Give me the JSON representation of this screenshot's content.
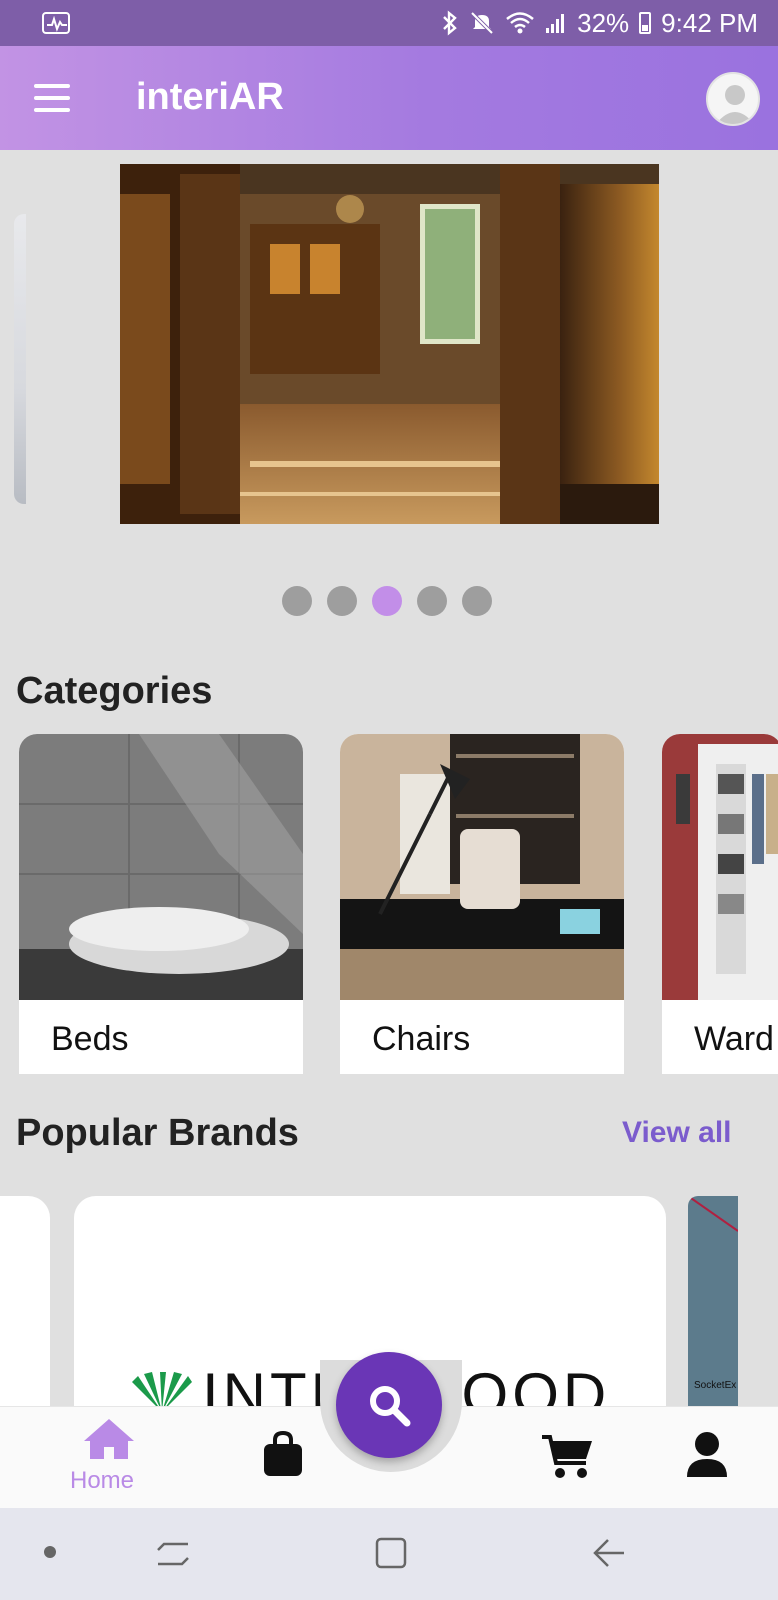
{
  "status_bar": {
    "battery": "32%",
    "time": "9:42 PM",
    "icons": [
      "activity-icon",
      "bluetooth-icon",
      "mute-icon",
      "wifi-icon",
      "signal-icon",
      "battery-icon"
    ]
  },
  "app_bar": {
    "title": "interiAR",
    "menu_icon": "menu-icon",
    "avatar_icon": "avatar-icon"
  },
  "carousel": {
    "slide_count": 5,
    "active_index": 2
  },
  "categories": {
    "title": "Categories",
    "items": [
      {
        "label": "Beds"
      },
      {
        "label": "Chairs"
      },
      {
        "label": "Ward"
      }
    ]
  },
  "brands": {
    "title": "Popular Brands",
    "view_all": "View all",
    "logo_text": "INTERWOOD",
    "partial_logo_text": "SocketEx"
  },
  "bottom_nav": {
    "items": [
      {
        "label": "Home",
        "icon": "home-icon",
        "active": true
      },
      {
        "label": "",
        "icon": "shopping-bag-icon",
        "active": false
      },
      {
        "label": "",
        "icon": "cart-icon",
        "active": false
      },
      {
        "label": "",
        "icon": "profile-icon",
        "active": false
      }
    ],
    "fab_icon": "search-icon"
  },
  "colors": {
    "accent": "#b98ae6",
    "fab": "#6a36b6",
    "link": "#7b5ccd",
    "status_bar": "#7e5ea8"
  }
}
